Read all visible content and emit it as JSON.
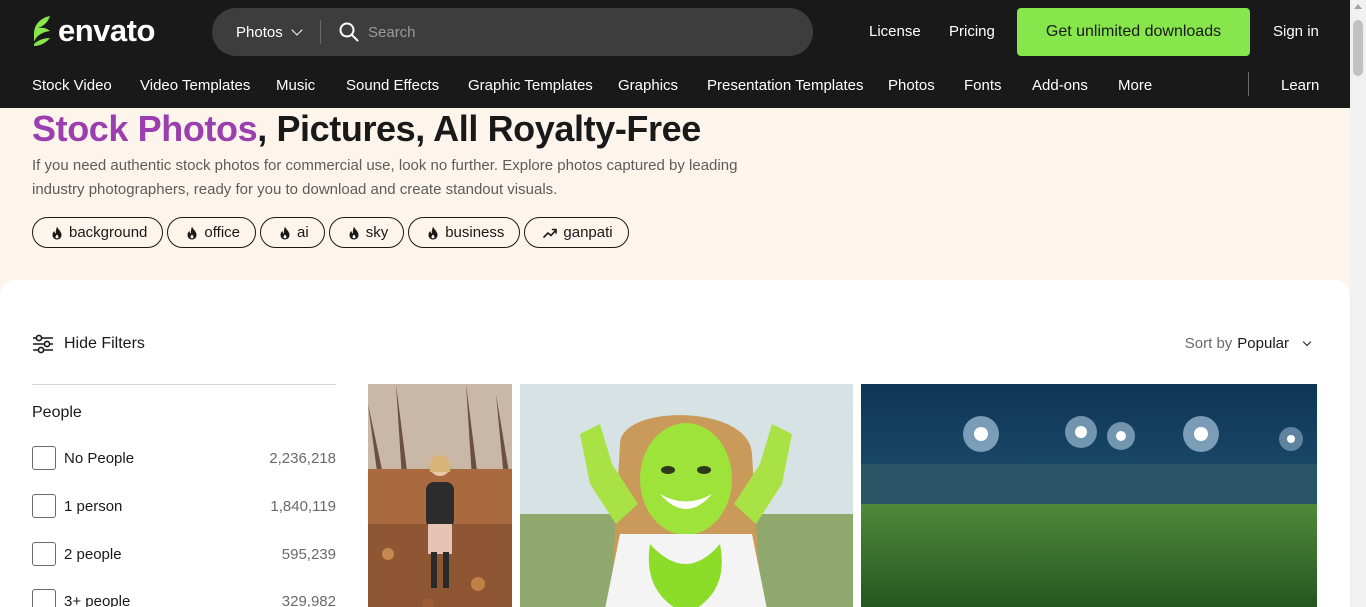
{
  "header": {
    "logo_text": "envato",
    "category_select": "Photos",
    "search_placeholder": "Search",
    "links": {
      "license": "License",
      "pricing": "Pricing",
      "signin": "Sign in"
    },
    "cta": "Get unlimited downloads"
  },
  "nav": {
    "items": [
      "Stock Video",
      "Video Templates",
      "Music",
      "Sound Effects",
      "Graphic Templates",
      "Graphics",
      "Presentation Templates",
      "Photos",
      "Fonts",
      "Add-ons",
      "More"
    ],
    "learn": "Learn"
  },
  "hero": {
    "title_accent": "Stock Photos",
    "title_rest": ", Pictures, All Royalty-Free",
    "description": "If you need authentic stock photos for commercial use, look no further. Explore photos captured by leading industry photographers, ready for you to download and create standout visuals.",
    "chips": [
      {
        "label": "background",
        "icon": "flame-icon"
      },
      {
        "label": "office",
        "icon": "flame-icon"
      },
      {
        "label": "ai",
        "icon": "flame-icon"
      },
      {
        "label": "sky",
        "icon": "flame-icon"
      },
      {
        "label": "business",
        "icon": "flame-icon"
      },
      {
        "label": "ganpati",
        "icon": "trending-up-icon"
      }
    ]
  },
  "filters": {
    "toggle_label": "Hide Filters",
    "sort_prefix": "Sort by",
    "sort_value": "Popular",
    "group_title": "People",
    "options": [
      {
        "label": "No People",
        "count": "2,236,218"
      },
      {
        "label": "1 person",
        "count": "1,840,119"
      },
      {
        "label": "2 people",
        "count": "595,239"
      },
      {
        "label": "3+ people",
        "count": "329,982"
      }
    ]
  },
  "photos": [
    {
      "subject": "child-in-autumn-leaves"
    },
    {
      "subject": "woman-with-green-powder-paint"
    },
    {
      "subject": "stadium-at-night"
    }
  ],
  "colors": {
    "header_bg": "#191919",
    "cta_bg": "#87e64b",
    "hero_bg": "#fdf4ec",
    "accent_purple": "#9b3fae"
  }
}
